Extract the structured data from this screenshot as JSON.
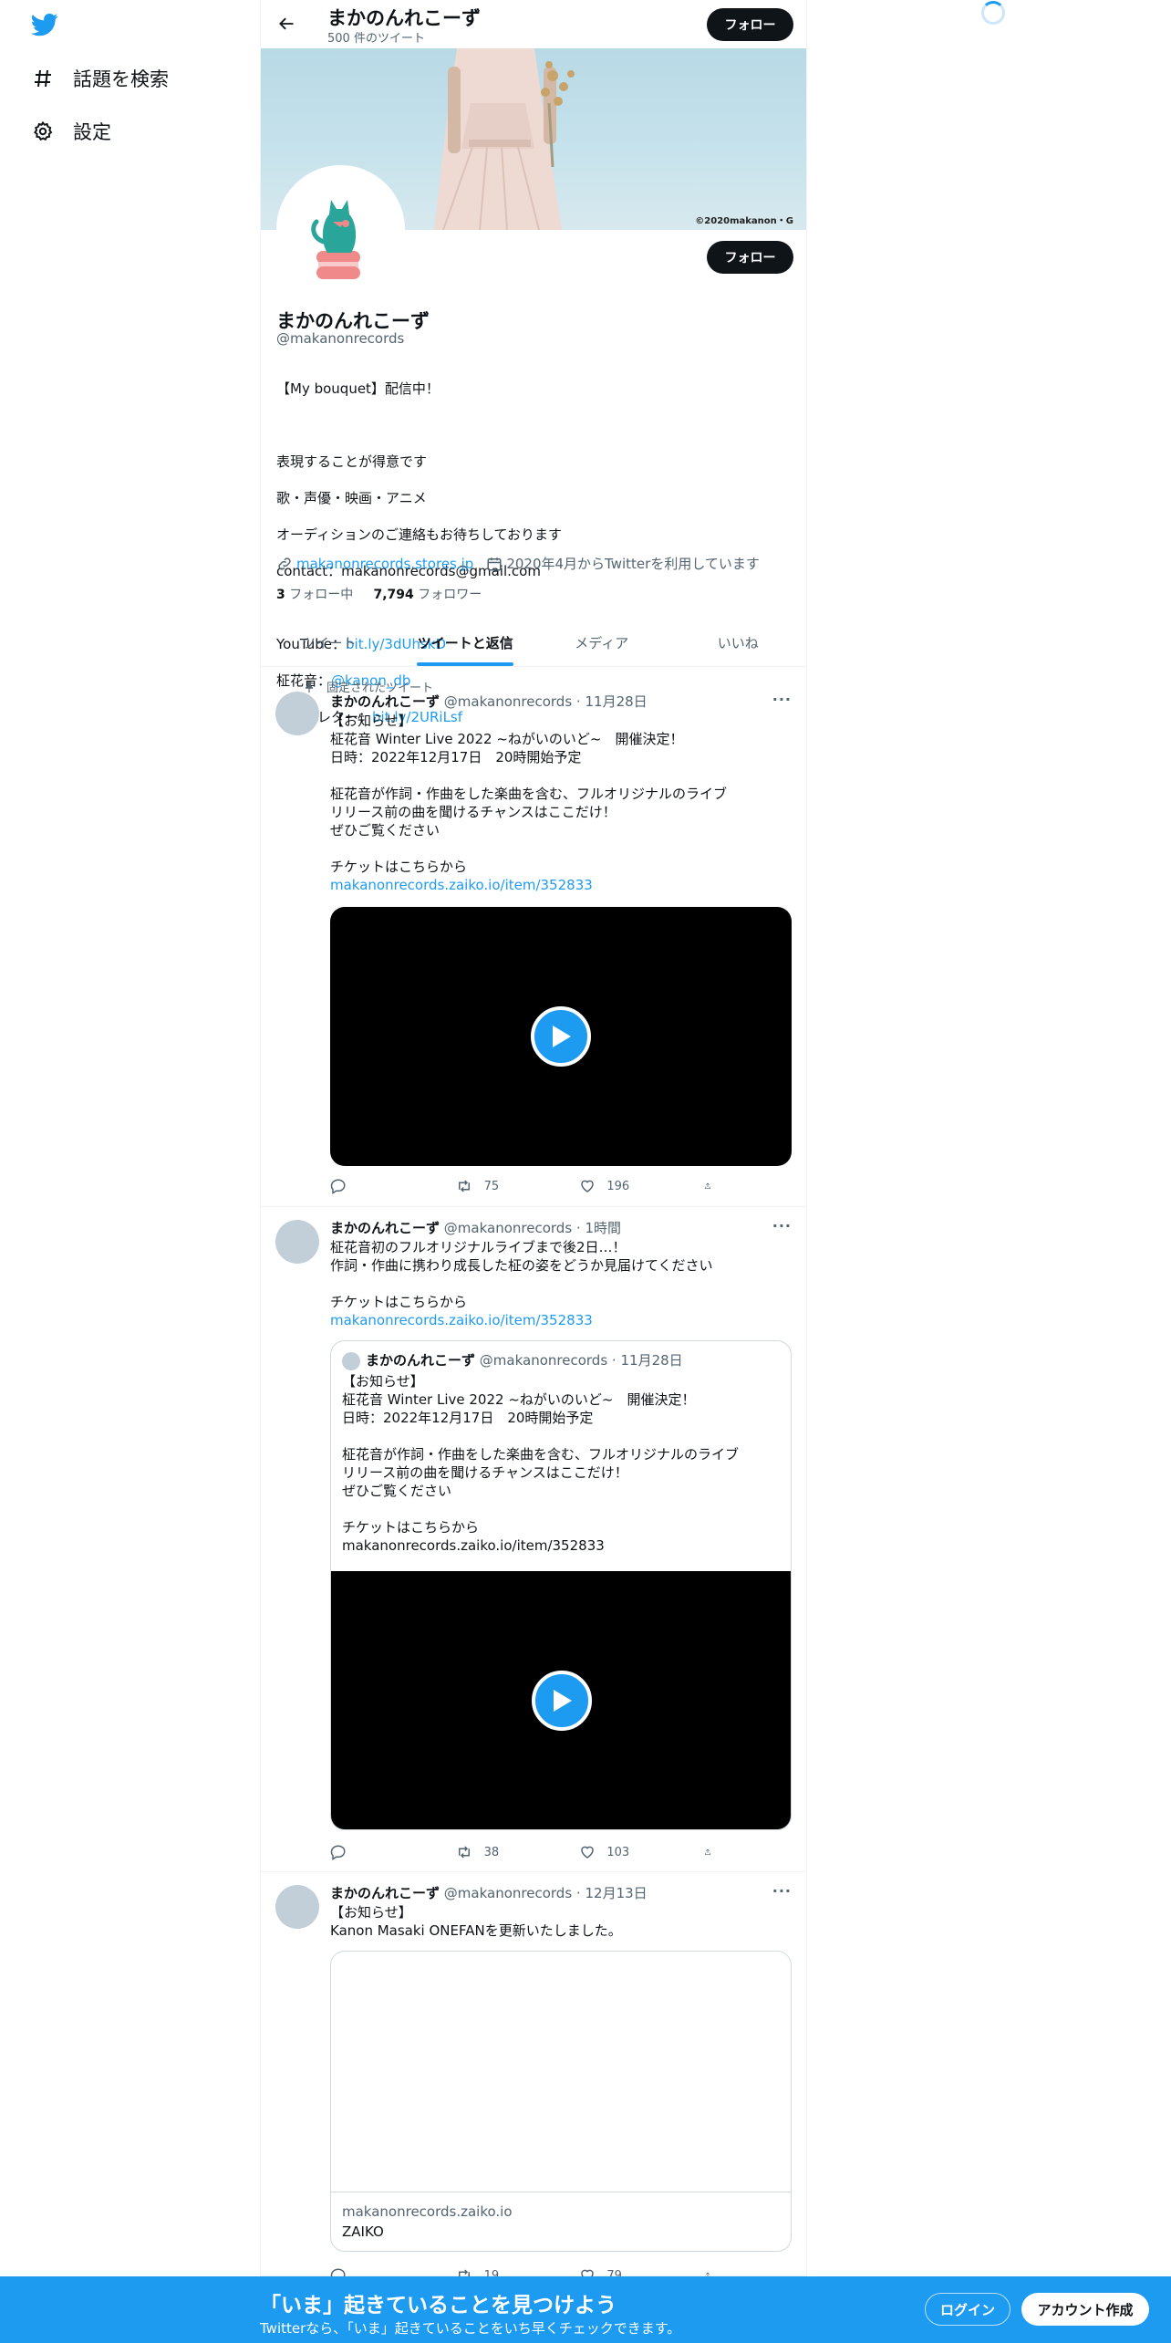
{
  "sidebar": {
    "logo": "twitter-bird-icon",
    "items": [
      {
        "icon": "hash-icon",
        "label": "話題を検索"
      },
      {
        "icon": "gear-icon",
        "label": "設定"
      }
    ]
  },
  "header": {
    "title": "まかのんれこーず",
    "tweet_count": "500 件のツイート",
    "follow_label": "フォロー"
  },
  "profile": {
    "banner_credit": "©2020makanon・G",
    "name": "まかのんれこーず",
    "handle": "@makanonrecords",
    "follow_label": "フォロー",
    "bio": {
      "l1": "【My bouquet】配信中！",
      "l2": "表現することが得意です",
      "l3": "歌・声優・映画・アニメ",
      "l4": "オーディションのご連絡もお待ちしております",
      "l5": "contact：makanonrecords@gmail.com",
      "youtube_prefix": "YouTube：",
      "youtube_link": "bit.ly/3dUhskD",
      "kanon_prefix": "柾花音：",
      "kanon_link": "@kanon_db",
      "fanletter_prefix": "ファンレター：",
      "fanletter_link": "bit.ly/2URiLsf"
    },
    "website": "makanonrecords.stores.jp",
    "joined": "2020年4月からTwitterを利用しています",
    "following_count": "3",
    "following_label": "フォロー中",
    "followers_count": "7,794",
    "followers_label": "フォロワー"
  },
  "tabs": [
    "ツイート",
    "ツイートと返信",
    "メディア",
    "いいね"
  ],
  "tweets": [
    {
      "pinned_label": "固定されたツイート",
      "name": "まかのんれこーず",
      "handle": "@makanonrecords",
      "time": "11月28日",
      "lines": [
        "【お知らせ】",
        "柾花音 Winter Live 2022 ~ねがいのいど~　開催決定！",
        "日時：2022年12月17日　20時開始予定",
        "",
        "柾花音が作詞・作曲をした楽曲を含む、フルオリジナルのライブ",
        "リリース前の曲を聞けるチャンスはここだけ！",
        "ぜひご覧ください",
        "",
        "チケットはこちらから"
      ],
      "link": "makanonrecords.zaiko.io/item/352833",
      "retweets": "75",
      "likes": "196"
    },
    {
      "name": "まかのんれこーず",
      "handle": "@makanonrecords",
      "time": "1時間",
      "lines": [
        "柾花音初のフルオリジナルライブまで後2日…！",
        "作詞・作曲に携わり成長した柾の姿をどうか見届けてください",
        "",
        "チケットはこちらから"
      ],
      "link": "makanonrecords.zaiko.io/item/352833",
      "quote": {
        "name": "まかのんれこーず",
        "handle": "@makanonrecords",
        "time": "11月28日",
        "lines": [
          "【お知らせ】",
          "柾花音 Winter Live 2022 ~ねがいのいど~　開催決定！",
          "日時：2022年12月17日　20時開始予定",
          "",
          "柾花音が作詞・作曲をした楽曲を含む、フルオリジナルのライブ",
          "リリース前の曲を聞けるチャンスはここだけ！",
          "ぜひご覧ください",
          "",
          "チケットはこちらから",
          "makanonrecords.zaiko.io/item/352833"
        ]
      },
      "retweets": "38",
      "likes": "103"
    },
    {
      "name": "まかのんれこーず",
      "handle": "@makanonrecords",
      "time": "12月13日",
      "lines": [
        "【お知らせ】",
        "Kanon Masaki ONEFANを更新いたしました。"
      ],
      "card": {
        "domain": "makanonrecords.zaiko.io",
        "title": "ZAIKO"
      },
      "retweets": "19",
      "likes": "79"
    }
  ],
  "bottom_bar": {
    "title": "「いま」起きていることを見つけよう",
    "subtitle": "Twitterなら、「いま」起きていることをいち早くチェックできます。",
    "login": "ログイン",
    "signup": "アカウント作成"
  },
  "colors": {
    "accent": "#1d9bf0",
    "text": "#0f1419",
    "secondary": "#536471"
  }
}
